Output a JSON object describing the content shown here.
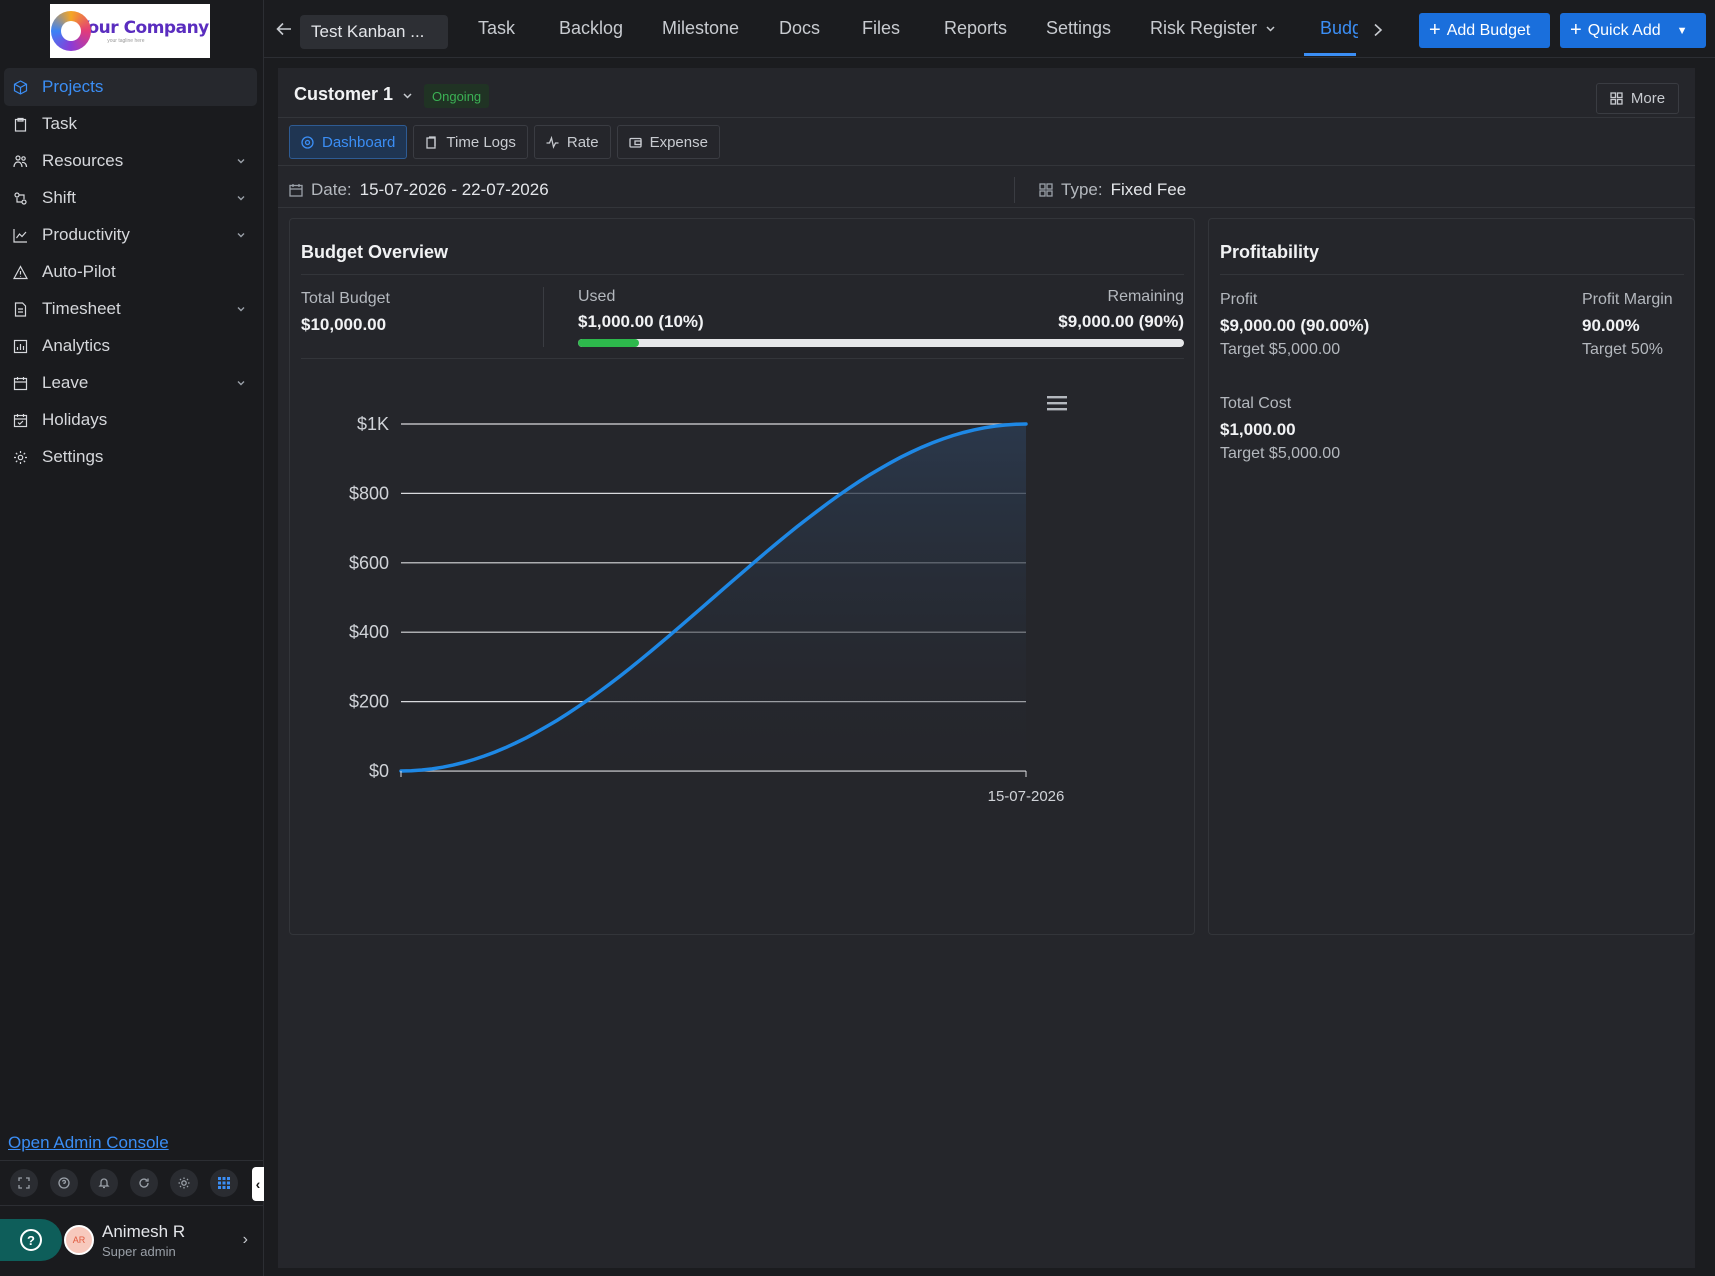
{
  "sidebar": {
    "logo_name": "Your Company",
    "logo_tagline": "your tagline here",
    "items": [
      {
        "label": "Projects",
        "icon": "cube-icon",
        "active": true,
        "has_children": false
      },
      {
        "label": "Task",
        "icon": "clipboard-icon",
        "active": false,
        "has_children": false
      },
      {
        "label": "Resources",
        "icon": "people-icon",
        "active": false,
        "has_children": true
      },
      {
        "label": "Shift",
        "icon": "shift-icon",
        "active": false,
        "has_children": true
      },
      {
        "label": "Productivity",
        "icon": "line-chart-icon",
        "active": false,
        "has_children": true
      },
      {
        "label": "Auto-Pilot",
        "icon": "triangle-icon",
        "active": false,
        "has_children": false
      },
      {
        "label": "Timesheet",
        "icon": "document-icon",
        "active": false,
        "has_children": true
      },
      {
        "label": "Analytics",
        "icon": "bar-chart-icon",
        "active": false,
        "has_children": false
      },
      {
        "label": "Leave",
        "icon": "calendar-icon",
        "active": false,
        "has_children": true
      },
      {
        "label": "Holidays",
        "icon": "calendar-check-icon",
        "active": false,
        "has_children": false
      },
      {
        "label": "Settings",
        "icon": "gear-icon",
        "active": false,
        "has_children": false
      }
    ],
    "admin_link": "Open Admin Console",
    "user": {
      "initials": "AR",
      "name": "Animesh R",
      "role": "Super admin"
    }
  },
  "topbar": {
    "project": "Test Kanban ...",
    "tabs": [
      "Task",
      "Backlog",
      "Milestone",
      "Docs",
      "Files",
      "Reports",
      "Settings",
      "Risk Register",
      "Budget"
    ],
    "active_tab": "Budget",
    "add_budget": "Add Budget",
    "quick_add": "Quick Add"
  },
  "header": {
    "customer": "Customer 1",
    "status": "Ongoing",
    "more": "More"
  },
  "subtabs": [
    "Dashboard",
    "Time Logs",
    "Rate",
    "Expense"
  ],
  "info": {
    "date_label": "Date:",
    "date_value": "15-07-2026 - 22-07-2026",
    "type_label": "Type:",
    "type_value": "Fixed Fee"
  },
  "budget_overview": {
    "title": "Budget Overview",
    "total_label": "Total Budget",
    "total_value": "$10,000.00",
    "used_label": "Used",
    "used_value": "$1,000.00 (10%)",
    "remaining_label": "Remaining",
    "remaining_value": "$9,000.00 (90%)",
    "used_fraction": 0.1
  },
  "profitability": {
    "title": "Profitability",
    "profit_label": "Profit",
    "profit_value": "$9,000.00 (90.00%)",
    "profit_target": "Target $5,000.00",
    "margin_label": "Profit Margin",
    "margin_value": "90.00%",
    "margin_target": "Target 50%",
    "cost_label": "Total Cost",
    "cost_value": "$1,000.00",
    "cost_target": "Target $5,000.00"
  },
  "colors": {
    "accent": "#3b8ef5",
    "primary_button": "#1a6fdc",
    "success": "#2db84c",
    "line": "#1e88e5"
  },
  "chart_data": {
    "type": "area",
    "x": [
      "15-07-2026"
    ],
    "series": [
      {
        "values": [
          0,
          1000
        ]
      }
    ],
    "y_ticks": [
      "$0",
      "$200",
      "$400",
      "$600",
      "$800",
      "$1K"
    ],
    "x_ticks": [
      "15-07-2026"
    ],
    "ylim": [
      0,
      1000
    ],
    "grid": true,
    "menu_icon": "hamburger-icon"
  }
}
